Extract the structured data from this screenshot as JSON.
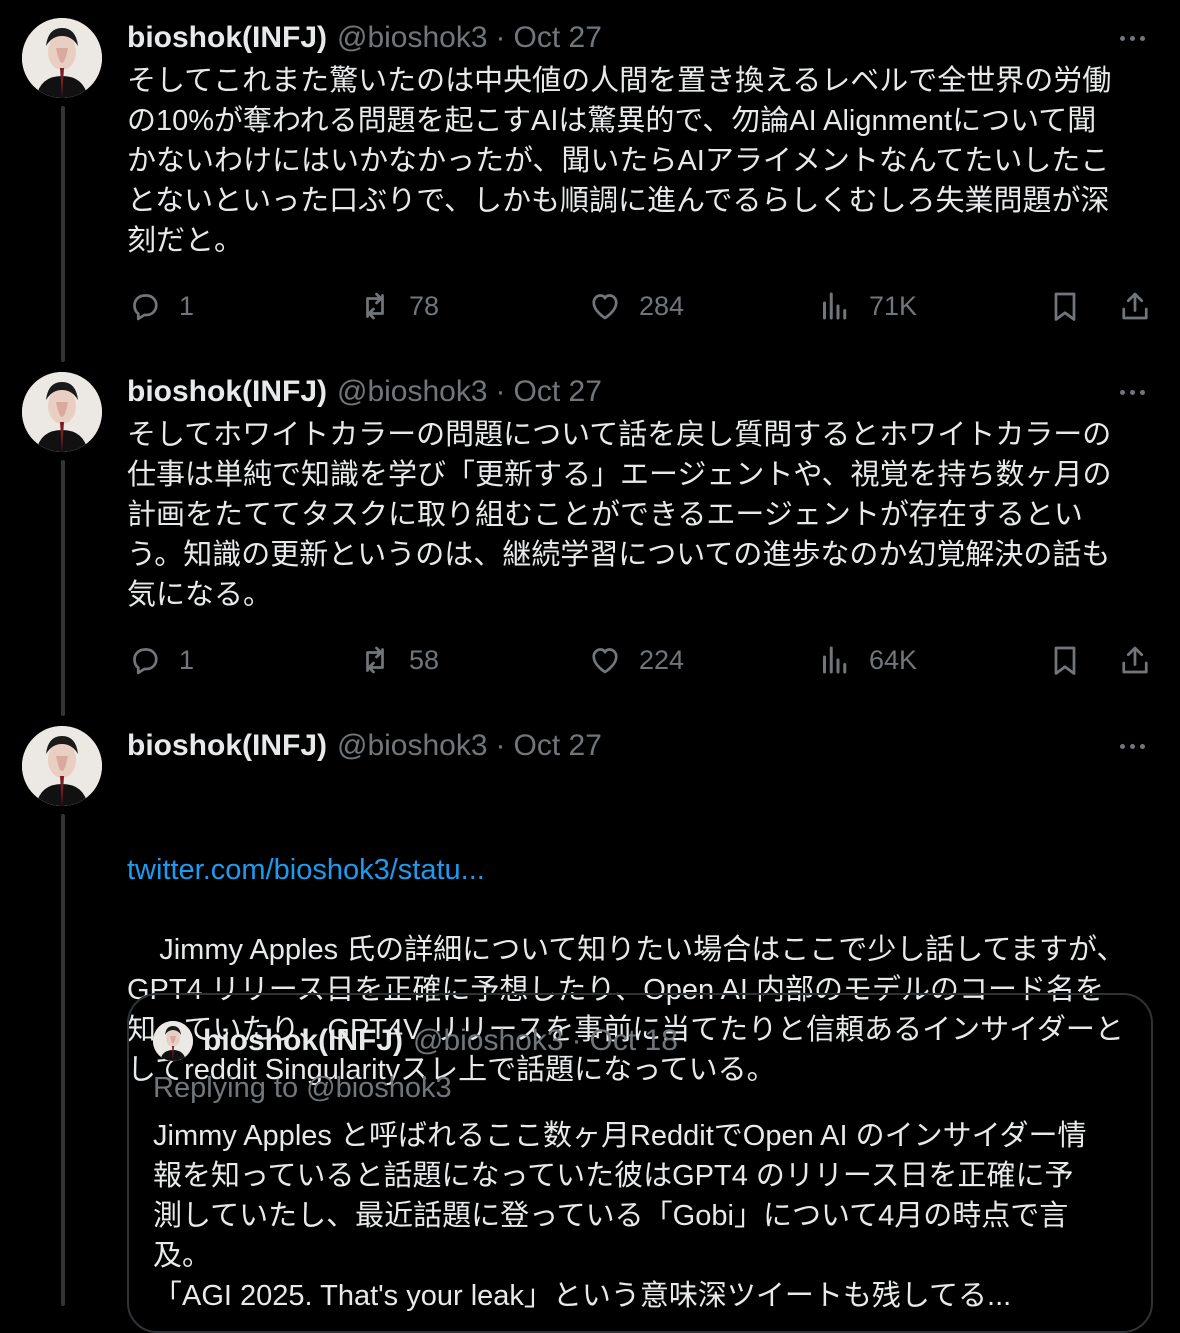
{
  "tweets": [
    {
      "author": {
        "display_name": "bioshok(INFJ)",
        "handle": "@bioshok3"
      },
      "separator": "·",
      "date": "Oct 27",
      "text": "そしてこれまた驚いたのは中央値の人間を置き換えるレベルで全世界の労働\nの10%が奪われる問題を起こすAIは驚異的で、勿論AI Alignmentについて聞\nかないわけにはいかなかったが、聞いたらAIアライメントなんてたいしたこ\nとないといった口ぶりで、しかも順調に進んでるらしくむしろ失業問題が深\n刻だと。",
      "stats": {
        "replies": "1",
        "reposts": "78",
        "likes": "284",
        "views": "71K"
      }
    },
    {
      "author": {
        "display_name": "bioshok(INFJ)",
        "handle": "@bioshok3"
      },
      "separator": "·",
      "date": "Oct 27",
      "text": "そしてホワイトカラーの問題について話を戻し質問するとホワイトカラーの\n仕事は単純で知識を学び「更新する」エージェントや、視覚を持ち数ヶ月の\n計画をたててタスクに取り組むことができるエージェントが存在するとい\nう。知識の更新というのは、継続学習についての進歩なのか幻覚解決の話も\n気になる。",
      "stats": {
        "replies": "1",
        "reposts": "58",
        "likes": "224",
        "views": "64K"
      }
    },
    {
      "author": {
        "display_name": "bioshok(INFJ)",
        "handle": "@bioshok3"
      },
      "separator": "·",
      "date": "Oct 27",
      "link": "twitter.com/bioshok3/statu...",
      "text": "Jimmy Apples 氏の詳細について知りたい場合はここで少し話してますが、\nGPT4 リリース日を正確に予想したり、Open AI 内部のモデルのコード名を\n知っていたり、GPT4V リリースを事前に当てたりと信頼あるインサイダーと\nしてreddit Singularityスレ上で話題になっている。"
    }
  ],
  "quoted_tweet": {
    "author": {
      "display_name": "bioshok(INFJ)",
      "handle": "@bioshok3"
    },
    "separator": "·",
    "date": "Oct 18",
    "replying_to": "Replying to @bioshok3",
    "text": "Jimmy Apples と呼ばれるここ数ヶ月RedditでOpen AI のインサイダー情\n報を知っていると話題になっていた彼はGPT4 のリリース日を正確に予\n測していたし、最近話題に登っている「Gobi」について4月の時点で言\n及。\n「AGI 2025. That's your leak」という意味深ツイートも残してる..."
  },
  "colors": {
    "background": "#000000",
    "text_primary": "#e7e9ea",
    "text_secondary": "#71767b",
    "link": "#1d9bf0",
    "border": "#2f3336"
  },
  "icons": {
    "more": "more-horizontal-icon",
    "reply": "reply-icon",
    "repost": "repost-icon",
    "like": "heart-icon",
    "views": "views-icon",
    "bookmark": "bookmark-icon",
    "share": "share-icon"
  }
}
